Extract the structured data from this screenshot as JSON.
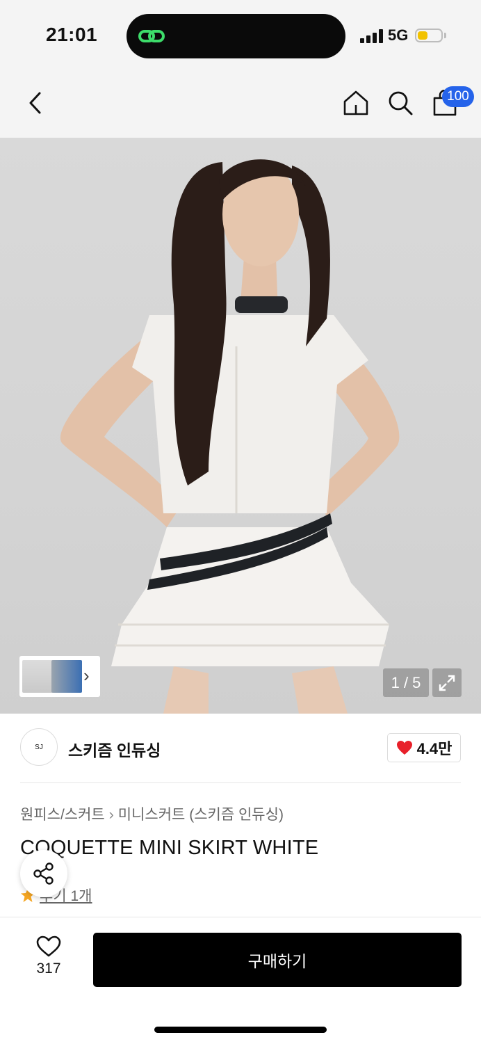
{
  "status_bar": {
    "time": "21:01",
    "network": "5G",
    "battery_color": "#f2c200"
  },
  "nav": {
    "back_icon": "chevron-left-icon",
    "home_icon": "home-icon",
    "search_icon": "search-icon",
    "cart_icon": "bag-icon",
    "cart_badge": "100",
    "badge_color": "#2563ea"
  },
  "gallery": {
    "page_indicator": "1 / 5",
    "expand_icon": "expand-icon",
    "thumb_chevron": "›"
  },
  "brand": {
    "logo_text": "SJ",
    "name": "스키즘 인듀싱",
    "likes": "4.4만",
    "heart_color": "#e8202a"
  },
  "breadcrumb": {
    "category": "원피스/스커트",
    "subcategory": "미니스커트 (스키즘 인듀싱)"
  },
  "product": {
    "title": "COQUETTE MINI SKIRT WHITE"
  },
  "reviews": {
    "link_text": "후기 1개",
    "star_color": "#f5a623"
  },
  "actions": {
    "share_icon": "share-icon",
    "wishlist_count": "317",
    "buy_label": "구매하기"
  }
}
